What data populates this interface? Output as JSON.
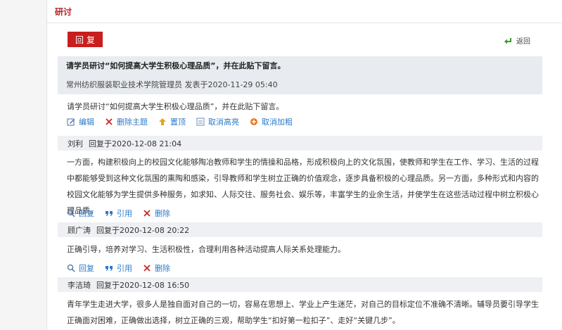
{
  "header": {
    "title": "研讨"
  },
  "toolbar": {
    "reply_label": "回复",
    "back_label": "返回"
  },
  "topic": {
    "title": "请学员研讨“如何提高大学生积极心理品质”，并在此贴下留言。",
    "meta": "常州纺织服装职业技术学院管理员 发表于2020-11-29 05:40",
    "body": "请学员研讨“如何提高大学生积极心理品质”，并在此贴下留言。",
    "actions": {
      "edit": "编辑",
      "delete_topic": "删除主题",
      "pin": "置顶",
      "unhighlight": "取消高亮",
      "unbold": "取消加粗"
    }
  },
  "reply_actions": {
    "reply": "回复",
    "quote": "引用",
    "delete": "删除"
  },
  "replies": [
    {
      "author": "刘利",
      "time": "回复于2020-12-08 21:04",
      "body": "一方面，构建积极向上的校园文化能够陶冶教师和学生的情操和品格，形成积极向上的文化氛围，使教师和学生在工作、学习、生活的过程中都能够受到这种文化氛围的熏陶和感染，引导教师和学生树立正确的价值观念，逐步具备积极的心理品质。另一方面，多种形式和内容的校园文化能够为学生提供多种服务，如求知、人际交往、服务社会、娱乐等，丰富学生的业余生活，并使学生在这些活动过程中树立积极心理品质。"
    },
    {
      "author": "顾广涛",
      "time": "回复于2020-12-08 20:22",
      "body": "正确引导，培养对学习、生活积极性，合理利用各种活动提高人际关系处理能力。"
    },
    {
      "author": "李洁琦",
      "time": "回复于2020-12-08 16:50",
      "body": "青年学生走进大学，很多人是独自面对自己的一切，容易在思想上、学业上产生迷茫，对自己的目标定位不准确不清晰。辅导员要引导学生正确面对困难，正确做出选择，树立正确的三观，帮助学生“扣好第一粒扣子”、走好“关键几步”。"
    }
  ],
  "colors": {
    "accent": "#c81e1e",
    "link": "#2b7ac9",
    "title_red": "#b52424"
  }
}
